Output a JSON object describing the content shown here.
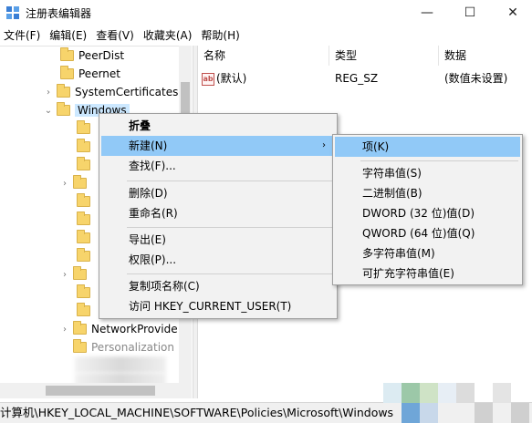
{
  "window": {
    "title": "注册表编辑器",
    "minimize": "—",
    "maximize": "☐",
    "close": "✕"
  },
  "menubar": [
    "文件(F)",
    "编辑(E)",
    "查看(V)",
    "收藏夹(A)",
    "帮助(H)"
  ],
  "tree": {
    "items": [
      {
        "label": "PeerDist",
        "chevron": ""
      },
      {
        "label": "Peernet",
        "chevron": ""
      },
      {
        "label": "SystemCertificates",
        "chevron": "›"
      },
      {
        "label": "Windows",
        "chevron": "⌄"
      }
    ],
    "lower_items": [
      {
        "label": "NetworkProvide",
        "chevron": "›"
      },
      {
        "label": "Personalization",
        "chevron": ""
      }
    ]
  },
  "list": {
    "columns": [
      "名称",
      "类型",
      "数据"
    ],
    "rows": [
      {
        "name": "(默认)",
        "type": "REG_SZ",
        "data": "(数值未设置)",
        "icon": "ab"
      }
    ]
  },
  "context_menu": {
    "items": [
      "折叠",
      "新建(N)",
      "查找(F)...",
      "删除(D)",
      "重命名(R)",
      "导出(E)",
      "权限(P)...",
      "复制项名称(C)",
      "访问 HKEY_CURRENT_USER(T)"
    ],
    "submenu_arrow": "›"
  },
  "submenu": {
    "items": [
      "项(K)",
      "字符串值(S)",
      "二进制值(B)",
      "DWORD (32 位)值(D)",
      "QWORD (64 位)值(Q)",
      "多字符串值(M)",
      "可扩充字符串值(E)"
    ]
  },
  "statusbar": {
    "path": "计算机\\HKEY_LOCAL_MACHINE\\SOFTWARE\\Policies\\Microsoft\\Windows"
  },
  "colors": {
    "highlight": "#91c9f7",
    "selection": "#cce8ff",
    "folder": "#f7d46b"
  }
}
